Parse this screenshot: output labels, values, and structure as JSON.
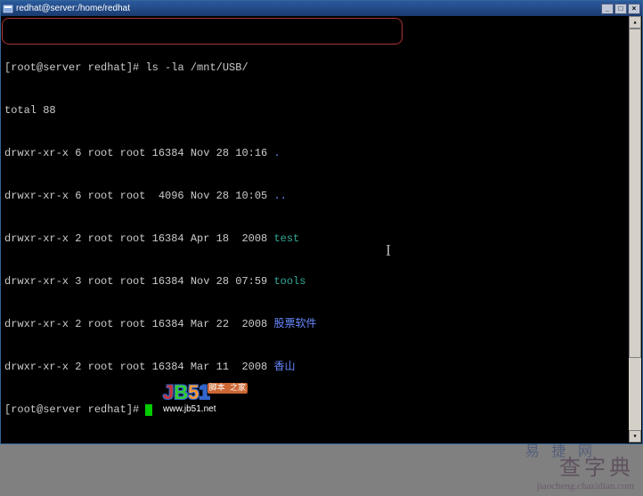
{
  "window": {
    "title": "redhat@server:/home/redhat",
    "buttons": {
      "min": "_",
      "max": "□",
      "close": "×"
    }
  },
  "terminal": {
    "prompt": "[root@server redhat]#",
    "command": "ls -la /mnt/USB/",
    "total": "total 88",
    "rows": [
      {
        "perm": "drwxr-xr-x 6 root root 16384 Nov 28 10:16 ",
        "name": ".",
        "cls": "dir-blue"
      },
      {
        "perm": "drwxr-xr-x 6 root root  4096 Nov 28 10:05 ",
        "name": "..",
        "cls": "dir-blue"
      },
      {
        "perm": "drwxr-xr-x 2 root root 16384 Apr 18  2008 ",
        "name": "test",
        "cls": "dir-cyan"
      },
      {
        "perm": "drwxr-xr-x 3 root root 16384 Nov 28 07:59 ",
        "name": "tools",
        "cls": "dir-cyan"
      },
      {
        "perm": "drwxr-xr-x 2 root root 16384 Mar 22  2008 ",
        "name": "股票软件",
        "cls": "dir-blue"
      },
      {
        "perm": "drwxr-xr-x 2 root root 16384 Mar 11  2008 ",
        "name": "香山",
        "cls": "dir-blue"
      }
    ]
  },
  "watermarks": {
    "jb51_badge": "脚本\n之家",
    "jb51_url": "www.jb51.net",
    "bottom_text": "查字典",
    "bottom_url": "jiaocheng.chazidian.com",
    "blur_text": "易 捷 网"
  }
}
